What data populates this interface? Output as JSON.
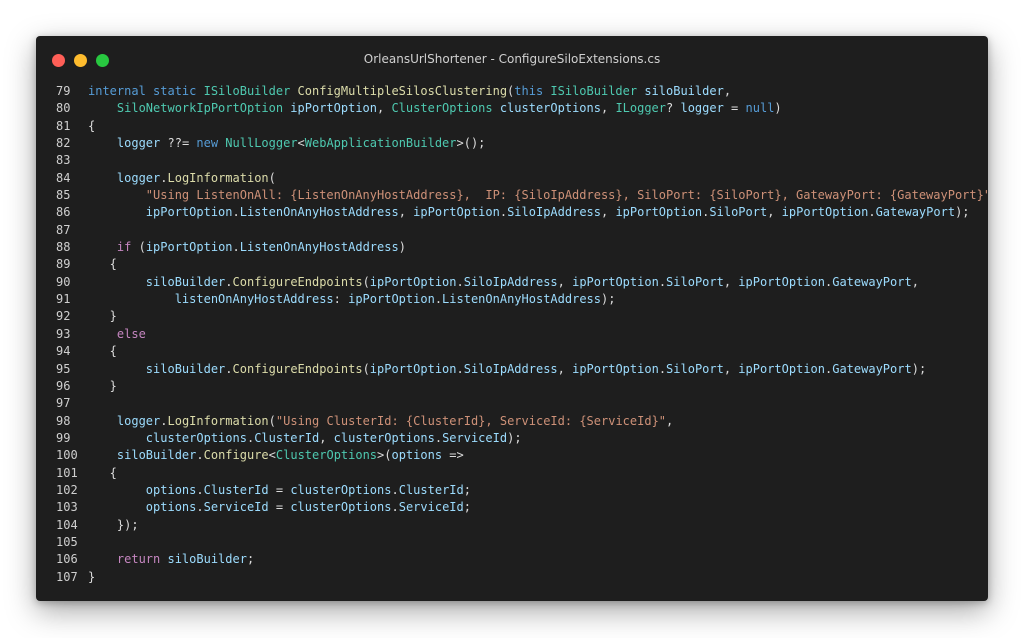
{
  "window": {
    "title": "OrleansUrlShortener - ConfigureSiloExtensions.cs",
    "controls": {
      "close": "red",
      "minimize": "yellow",
      "maximize": "green"
    }
  },
  "editor": {
    "lines": [
      {
        "number": "79",
        "tokens": [
          [
            "kw",
            "internal "
          ],
          [
            "kw",
            "static "
          ],
          [
            "type",
            "ISiloBuilder "
          ],
          [
            "method",
            "ConfigMultipleSilosClustering"
          ],
          [
            "p",
            "("
          ],
          [
            "kw",
            "this "
          ],
          [
            "type",
            "ISiloBuilder "
          ],
          [
            "id",
            "siloBuilder"
          ],
          [
            "p",
            ","
          ]
        ]
      },
      {
        "number": "80",
        "tokens": [
          [
            "p",
            "    "
          ],
          [
            "type",
            "SiloNetworkIpPortOption "
          ],
          [
            "id",
            "ipPortOption"
          ],
          [
            "p",
            ", "
          ],
          [
            "type",
            "ClusterOptions "
          ],
          [
            "id",
            "clusterOptions"
          ],
          [
            "p",
            ", "
          ],
          [
            "type",
            "ILogger"
          ],
          [
            "p",
            "? "
          ],
          [
            "id",
            "logger"
          ],
          [
            "p",
            " = "
          ],
          [
            "kw",
            "null"
          ],
          [
            "p",
            ")"
          ]
        ]
      },
      {
        "number": "81",
        "tokens": [
          [
            "p",
            "{"
          ]
        ]
      },
      {
        "number": "82",
        "tokens": [
          [
            "p",
            "    "
          ],
          [
            "id",
            "logger"
          ],
          [
            "p",
            " ??= "
          ],
          [
            "kw",
            "new "
          ],
          [
            "type",
            "NullLogger"
          ],
          [
            "p",
            "<"
          ],
          [
            "type",
            "WebApplicationBuilder"
          ],
          [
            "p",
            ">();"
          ]
        ]
      },
      {
        "number": "83",
        "tokens": []
      },
      {
        "number": "84",
        "tokens": [
          [
            "p",
            "    "
          ],
          [
            "id",
            "logger"
          ],
          [
            "p",
            "."
          ],
          [
            "method",
            "LogInformation"
          ],
          [
            "p",
            "("
          ]
        ]
      },
      {
        "number": "85",
        "tokens": [
          [
            "p",
            "        "
          ],
          [
            "str",
            "\"Using ListenOnAll: {ListenOnAnyHostAddress},  IP: {SiloIpAddress}, SiloPort: {SiloPort}, GatewayPort: {GatewayPort}\""
          ],
          [
            "p",
            ","
          ]
        ]
      },
      {
        "number": "86",
        "tokens": [
          [
            "p",
            "        "
          ],
          [
            "id",
            "ipPortOption"
          ],
          [
            "p",
            "."
          ],
          [
            "id",
            "ListenOnAnyHostAddress"
          ],
          [
            "p",
            ", "
          ],
          [
            "id",
            "ipPortOption"
          ],
          [
            "p",
            "."
          ],
          [
            "id",
            "SiloIpAddress"
          ],
          [
            "p",
            ", "
          ],
          [
            "id",
            "ipPortOption"
          ],
          [
            "p",
            "."
          ],
          [
            "id",
            "SiloPort"
          ],
          [
            "p",
            ", "
          ],
          [
            "id",
            "ipPortOption"
          ],
          [
            "p",
            "."
          ],
          [
            "id",
            "GatewayPort"
          ],
          [
            "p",
            ");"
          ]
        ]
      },
      {
        "number": "87",
        "tokens": []
      },
      {
        "number": "88",
        "tokens": [
          [
            "p",
            "    "
          ],
          [
            "ctl",
            "if "
          ],
          [
            "p",
            "("
          ],
          [
            "id",
            "ipPortOption"
          ],
          [
            "p",
            "."
          ],
          [
            "id",
            "ListenOnAnyHostAddress"
          ],
          [
            "p",
            ")"
          ]
        ]
      },
      {
        "number": "89",
        "tokens": [
          [
            "p",
            "   {"
          ]
        ]
      },
      {
        "number": "90",
        "tokens": [
          [
            "p",
            "        "
          ],
          [
            "id",
            "siloBuilder"
          ],
          [
            "p",
            "."
          ],
          [
            "method",
            "ConfigureEndpoints"
          ],
          [
            "p",
            "("
          ],
          [
            "id",
            "ipPortOption"
          ],
          [
            "p",
            "."
          ],
          [
            "id",
            "SiloIpAddress"
          ],
          [
            "p",
            ", "
          ],
          [
            "id",
            "ipPortOption"
          ],
          [
            "p",
            "."
          ],
          [
            "id",
            "SiloPort"
          ],
          [
            "p",
            ", "
          ],
          [
            "id",
            "ipPortOption"
          ],
          [
            "p",
            "."
          ],
          [
            "id",
            "GatewayPort"
          ],
          [
            "p",
            ","
          ]
        ]
      },
      {
        "number": "91",
        "tokens": [
          [
            "p",
            "            "
          ],
          [
            "id",
            "listenOnAnyHostAddress"
          ],
          [
            "p",
            ": "
          ],
          [
            "id",
            "ipPortOption"
          ],
          [
            "p",
            "."
          ],
          [
            "id",
            "ListenOnAnyHostAddress"
          ],
          [
            "p",
            ");"
          ]
        ]
      },
      {
        "number": "92",
        "tokens": [
          [
            "p",
            "   }"
          ]
        ]
      },
      {
        "number": "93",
        "tokens": [
          [
            "p",
            "    "
          ],
          [
            "ctl",
            "else"
          ]
        ]
      },
      {
        "number": "94",
        "tokens": [
          [
            "p",
            "   {"
          ]
        ]
      },
      {
        "number": "95",
        "tokens": [
          [
            "p",
            "        "
          ],
          [
            "id",
            "siloBuilder"
          ],
          [
            "p",
            "."
          ],
          [
            "method",
            "ConfigureEndpoints"
          ],
          [
            "p",
            "("
          ],
          [
            "id",
            "ipPortOption"
          ],
          [
            "p",
            "."
          ],
          [
            "id",
            "SiloIpAddress"
          ],
          [
            "p",
            ", "
          ],
          [
            "id",
            "ipPortOption"
          ],
          [
            "p",
            "."
          ],
          [
            "id",
            "SiloPort"
          ],
          [
            "p",
            ", "
          ],
          [
            "id",
            "ipPortOption"
          ],
          [
            "p",
            "."
          ],
          [
            "id",
            "GatewayPort"
          ],
          [
            "p",
            ");"
          ]
        ]
      },
      {
        "number": "96",
        "tokens": [
          [
            "p",
            "   }"
          ]
        ]
      },
      {
        "number": "97",
        "tokens": []
      },
      {
        "number": "98",
        "tokens": [
          [
            "p",
            "    "
          ],
          [
            "id",
            "logger"
          ],
          [
            "p",
            "."
          ],
          [
            "method",
            "LogInformation"
          ],
          [
            "p",
            "("
          ],
          [
            "str",
            "\"Using ClusterId: {ClusterId}, ServiceId: {ServiceId}\""
          ],
          [
            "p",
            ","
          ]
        ]
      },
      {
        "number": "99",
        "tokens": [
          [
            "p",
            "        "
          ],
          [
            "id",
            "clusterOptions"
          ],
          [
            "p",
            "."
          ],
          [
            "id",
            "ClusterId"
          ],
          [
            "p",
            ", "
          ],
          [
            "id",
            "clusterOptions"
          ],
          [
            "p",
            "."
          ],
          [
            "id",
            "ServiceId"
          ],
          [
            "p",
            ");"
          ]
        ]
      },
      {
        "number": "100",
        "tokens": [
          [
            "p",
            "    "
          ],
          [
            "id",
            "siloBuilder"
          ],
          [
            "p",
            "."
          ],
          [
            "method",
            "Configure"
          ],
          [
            "p",
            "<"
          ],
          [
            "type",
            "ClusterOptions"
          ],
          [
            "p",
            ">("
          ],
          [
            "id",
            "options"
          ],
          [
            "p",
            " =>"
          ]
        ]
      },
      {
        "number": "101",
        "tokens": [
          [
            "p",
            "   {"
          ]
        ]
      },
      {
        "number": "102",
        "tokens": [
          [
            "p",
            "        "
          ],
          [
            "id",
            "options"
          ],
          [
            "p",
            "."
          ],
          [
            "id",
            "ClusterId"
          ],
          [
            "p",
            " = "
          ],
          [
            "id",
            "clusterOptions"
          ],
          [
            "p",
            "."
          ],
          [
            "id",
            "ClusterId"
          ],
          [
            "p",
            ";"
          ]
        ]
      },
      {
        "number": "103",
        "tokens": [
          [
            "p",
            "        "
          ],
          [
            "id",
            "options"
          ],
          [
            "p",
            "."
          ],
          [
            "id",
            "ServiceId"
          ],
          [
            "p",
            " = "
          ],
          [
            "id",
            "clusterOptions"
          ],
          [
            "p",
            "."
          ],
          [
            "id",
            "ServiceId"
          ],
          [
            "p",
            ";"
          ]
        ]
      },
      {
        "number": "104",
        "tokens": [
          [
            "p",
            "    });"
          ]
        ]
      },
      {
        "number": "105",
        "tokens": []
      },
      {
        "number": "106",
        "tokens": [
          [
            "p",
            "    "
          ],
          [
            "ctl",
            "return "
          ],
          [
            "id",
            "siloBuilder"
          ],
          [
            "p",
            ";"
          ]
        ]
      },
      {
        "number": "107",
        "tokens": [
          [
            "p",
            "}"
          ]
        ]
      }
    ]
  }
}
